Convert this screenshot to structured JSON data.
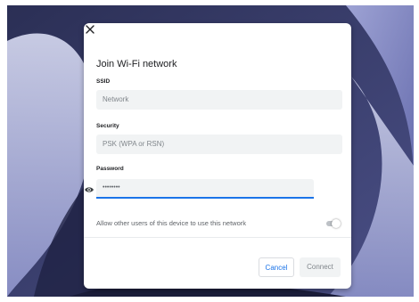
{
  "dialog": {
    "title": "Join Wi-Fi network",
    "close_icon": "close-icon",
    "ssid": {
      "label": "SSID",
      "placeholder": "Network"
    },
    "security": {
      "label": "Security",
      "value": "PSK (WPA or RSN)"
    },
    "password": {
      "label": "Password",
      "value": "••••••••",
      "reveal_icon": "eye-icon"
    },
    "allow_others": {
      "label": "Allow other users of this device to use this network",
      "enabled": false
    },
    "buttons": {
      "cancel": "Cancel",
      "connect": "Connect"
    }
  },
  "colors": {
    "accent": "#1a73e8",
    "wallpaper_dark": "#2b2f55",
    "wallpaper_light": "#9ea3d6"
  }
}
